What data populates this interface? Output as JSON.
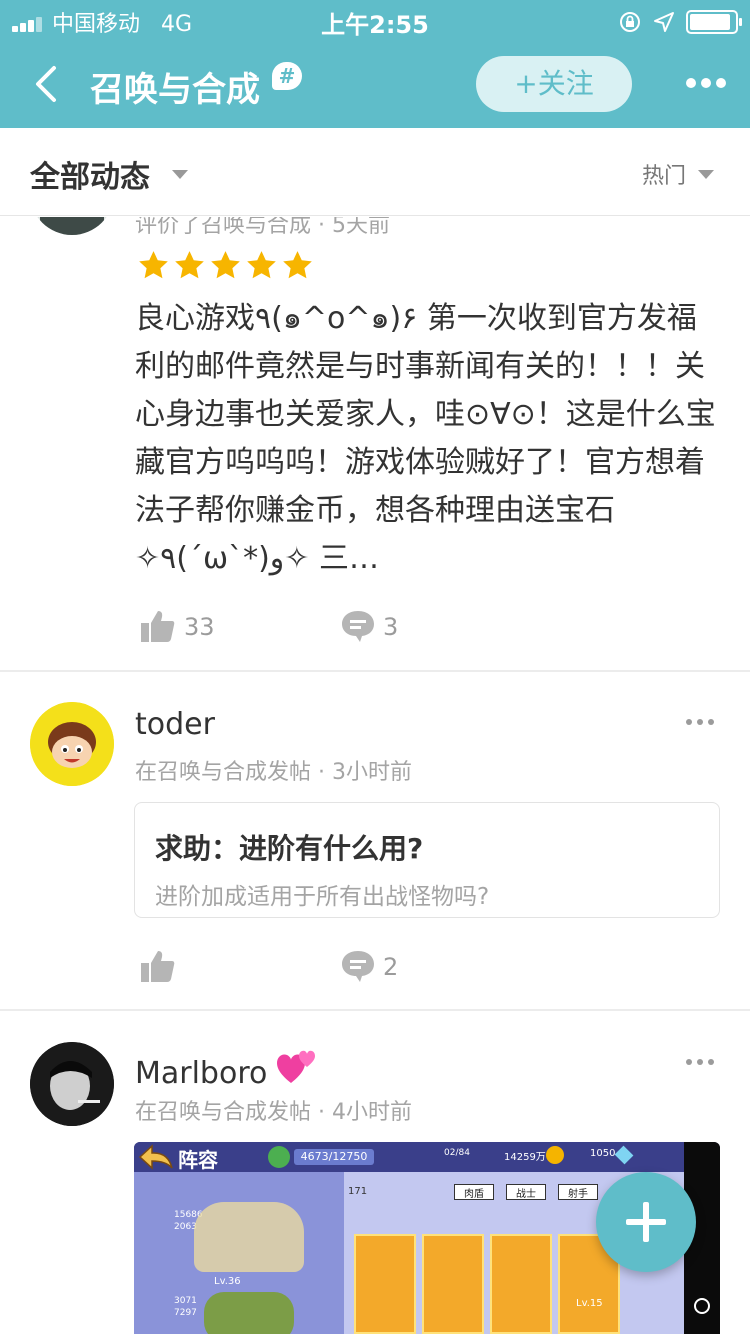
{
  "status_bar": {
    "carrier": "中国移动",
    "network": "4G",
    "time": "上午2:55",
    "battery_level": 0.9
  },
  "nav": {
    "title": "召唤与合成",
    "topic_badge": "#",
    "follow_label": "+关注"
  },
  "filter": {
    "scope_label": "全部动态",
    "sort_label": "热门"
  },
  "posts": [
    {
      "meta": "评价了召唤与合成 · 5天前",
      "rating": 5,
      "text": "良心游戏٩(๑^o^๑)۶ 第一次收到官方发福利的邮件竟然是与时事新闻有关的！！！关心身边事也关爱家人，哇⊙∀⊙！这是什么宝藏官方呜呜呜！游戏体验贼好了！官方想着法子帮你赚金币，想各种理由送宝石✧٩(ˊωˋ*)و✧ 三…",
      "likes": "33",
      "comments": "3"
    },
    {
      "username": "toder",
      "meta": "在召唤与合成发帖 · 3小时前",
      "card_title": "求助：进阶有什么用?",
      "card_subtitle": "进阶加成适用于所有出战怪物吗?",
      "likes": "",
      "comments": "2"
    },
    {
      "username": "Marlboro",
      "meta": "在召唤与合成发帖 · 4小时前",
      "screenshot": {
        "title": "阵容",
        "exp": "4673/12750",
        "stamina": "02/84",
        "coins": "14259万",
        "gems": "1050",
        "power": "171",
        "tabs": [
          "肉盾",
          "战士",
          "射手"
        ],
        "team_stats": [
          "15686",
          "2063"
        ],
        "team_stats_2": [
          "3071",
          "7297"
        ],
        "levels": [
          "Lv.36",
          "Lv.15"
        ]
      }
    }
  ],
  "colors": {
    "accent": "#5fbdc9",
    "star": "#f7b500",
    "meta_grey": "#a4a4a4"
  }
}
